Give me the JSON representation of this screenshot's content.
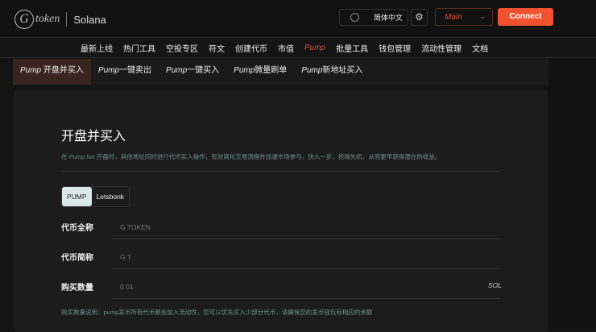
{
  "header": {
    "logo_text": "token",
    "chain": "Solana",
    "language": "简体中文",
    "network": "Main",
    "connect": "Connect"
  },
  "nav": [
    "最新上线",
    "热门工具",
    "空投专区",
    "符文",
    "创建代币",
    "市值",
    "Pump",
    "批量工具",
    "钱包管理",
    "流动性管理",
    "文档"
  ],
  "subtabs": [
    {
      "prefix": "Pump",
      "label": " 开盘并买入"
    },
    {
      "prefix": "Pump",
      "label": "一键卖出"
    },
    {
      "prefix": "Pump",
      "label": "一键买入"
    },
    {
      "prefix": "Pump",
      "label": "微量刷单"
    },
    {
      "prefix": "Pump",
      "label": "新地址买入"
    }
  ],
  "main": {
    "title": "开盘并买入",
    "desc_pre": "在 ",
    "desc_em": "Pump.fun",
    "desc_post": " 开盘时，其他地址同时进行代币买入操作，有效简化交易流程并加速市场参与，快人一步，抢得先机，从而更早获得潜在的收益。",
    "platforms": [
      "PUMP",
      "Letsbonk"
    ],
    "fields": [
      {
        "label": "代币全称",
        "placeholder": "G TOKEN"
      },
      {
        "label": "代币简称",
        "placeholder": "G T"
      },
      {
        "label": "购买数量",
        "placeholder": "0.01",
        "unit": "SOL"
      }
    ],
    "note": "购买数量说明：pump发币所有代币都会加入流动性，您可以优先买入少部分代币，请确保您的发币钱包有相应的余额"
  }
}
